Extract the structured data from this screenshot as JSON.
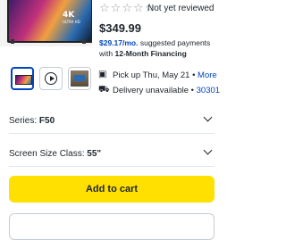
{
  "product_image": {
    "badge": "4K",
    "badge_sub": "ULTRA HD"
  },
  "rating": {
    "stars": 5,
    "text": "Not yet reviewed"
  },
  "price": {
    "value": "$349.99"
  },
  "financing": {
    "amount": "$29.17/mo.",
    "middle": " suggested payments with ",
    "term": "12-Month Financing"
  },
  "thumbnails": [
    {
      "name": "product-photo",
      "selected": true
    },
    {
      "name": "video"
    },
    {
      "name": "lifestyle-photo"
    }
  ],
  "fulfillment": {
    "pickup": {
      "text": "Pick up Thu, May 21 • ",
      "link": "More"
    },
    "delivery": {
      "text": "Delivery unavailable • ",
      "link": "30301"
    }
  },
  "selectors": {
    "series": {
      "label": "Series: ",
      "value": "F50"
    },
    "size": {
      "label": "Screen Size Class: ",
      "value": "55\""
    }
  },
  "cart": {
    "label": "Add to cart"
  },
  "colors": {
    "accent": "#0046be",
    "cart_button": "#ffe000"
  },
  "icons": {
    "pickup": "store-icon",
    "delivery": "truck-icon",
    "play": "play-icon",
    "chevron": "chevron-down-icon"
  }
}
